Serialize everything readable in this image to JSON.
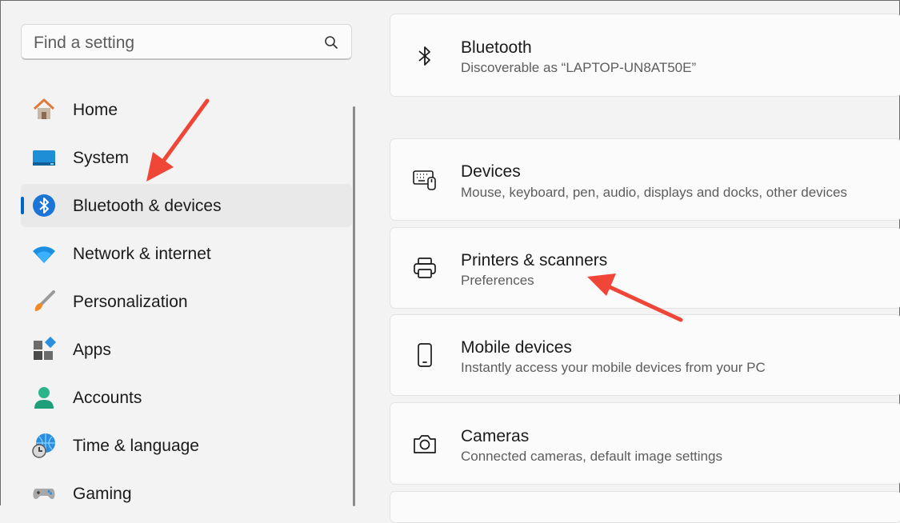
{
  "search": {
    "placeholder": "Find a setting"
  },
  "sidebar": {
    "items": [
      {
        "label": "Home",
        "icon": "home-icon"
      },
      {
        "label": "System",
        "icon": "monitor-icon"
      },
      {
        "label": "Bluetooth & devices",
        "icon": "bluetooth-icon",
        "active": true
      },
      {
        "label": "Network & internet",
        "icon": "wifi-icon"
      },
      {
        "label": "Personalization",
        "icon": "brush-icon"
      },
      {
        "label": "Apps",
        "icon": "apps-icon"
      },
      {
        "label": "Accounts",
        "icon": "person-icon"
      },
      {
        "label": "Time & language",
        "icon": "globe-clock-icon"
      },
      {
        "label": "Gaming",
        "icon": "gamepad-icon"
      }
    ]
  },
  "main": {
    "bluetooth": {
      "title": "Bluetooth",
      "subtitle": "Discoverable as “LAPTOP-UN8AT50E”"
    },
    "cards": [
      {
        "title": "Devices",
        "subtitle": "Mouse, keyboard, pen, audio, displays and docks, other devices",
        "icon": "keyboard-mouse-icon"
      },
      {
        "title": "Printers & scanners",
        "subtitle": "Preferences",
        "icon": "printer-icon"
      },
      {
        "title": "Mobile devices",
        "subtitle": "Instantly access your mobile devices from your PC",
        "icon": "phone-icon"
      },
      {
        "title": "Cameras",
        "subtitle": "Connected cameras, default image settings",
        "icon": "camera-icon"
      }
    ]
  },
  "colors": {
    "accent": "#0067c0",
    "annotation_arrow": "#ef4638"
  }
}
